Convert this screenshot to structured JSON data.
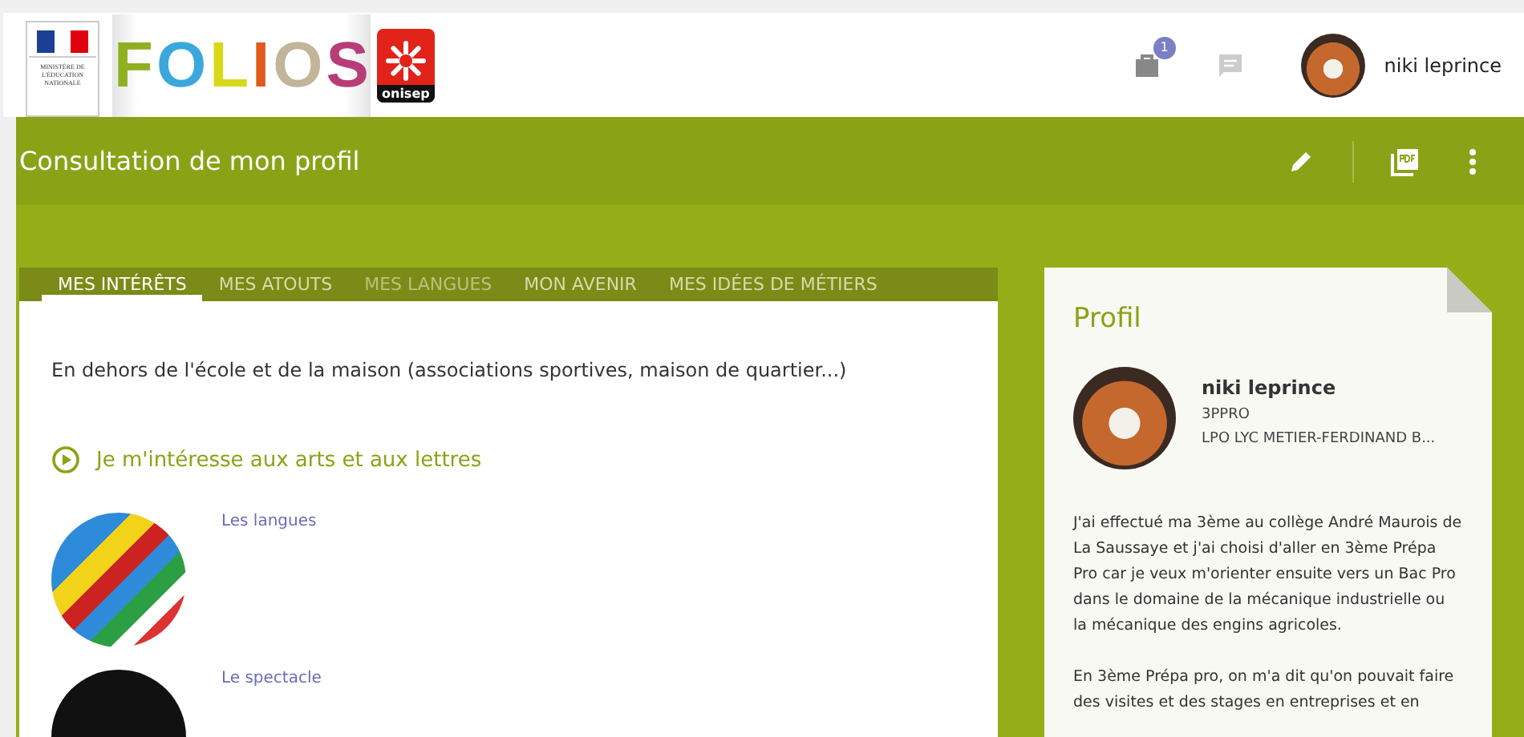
{
  "header": {
    "ministry": "MINISTÈRE DE L'ÉDUCATION NATIONALE",
    "logo_letters": [
      {
        "letter": "F",
        "color": "#8fb021"
      },
      {
        "letter": "O",
        "color": "#3aa8dc"
      },
      {
        "letter": "L",
        "color": "#d8d81a"
      },
      {
        "letter": "I",
        "color": "#e05a1c"
      },
      {
        "letter": "O",
        "color": "#c2b59a"
      },
      {
        "letter": "S",
        "color": "#b83c78"
      }
    ],
    "partner": "onisep",
    "notifications_badge": "1",
    "user_name": "niki leprince"
  },
  "page": {
    "title": "Consultation de mon profil"
  },
  "tabs": [
    {
      "label": "MES INTÉRÊTS",
      "selected": true,
      "disabled": false
    },
    {
      "label": "MES ATOUTS",
      "selected": false,
      "disabled": false
    },
    {
      "label": "MES LANGUES",
      "selected": false,
      "disabled": true
    },
    {
      "label": "MON AVENIR",
      "selected": false,
      "disabled": false
    },
    {
      "label": "MES IDÉES DE MÉTIERS",
      "selected": false,
      "disabled": false
    }
  ],
  "interests": {
    "intro": "En dehors de l'école et de la maison (associations sportives, maison de quartier...)",
    "section_title": "Je m'intéresse aux arts et aux lettres",
    "items": [
      {
        "label": "Les langues",
        "kind": "flags"
      },
      {
        "label": "Le spectacle",
        "kind": "dark"
      }
    ]
  },
  "profile": {
    "title": "Profil",
    "name": "niki leprince",
    "class": "3PPRO",
    "school": "LPO LYC METIER-FERDINAND B...",
    "paragraphs": [
      "J'ai effectué ma 3ème au collège André Maurois de La Saussaye et j'ai choisi d'aller en 3ème Prépa Pro car je veux m'orienter ensuite vers un Bac Pro dans le domaine de la mécanique industrielle ou la mécanique des engins agricoles.",
      "En 3ème Prépa pro, on m'a dit qu'on pouvait faire des visites et des stages en entreprises et en"
    ]
  }
}
